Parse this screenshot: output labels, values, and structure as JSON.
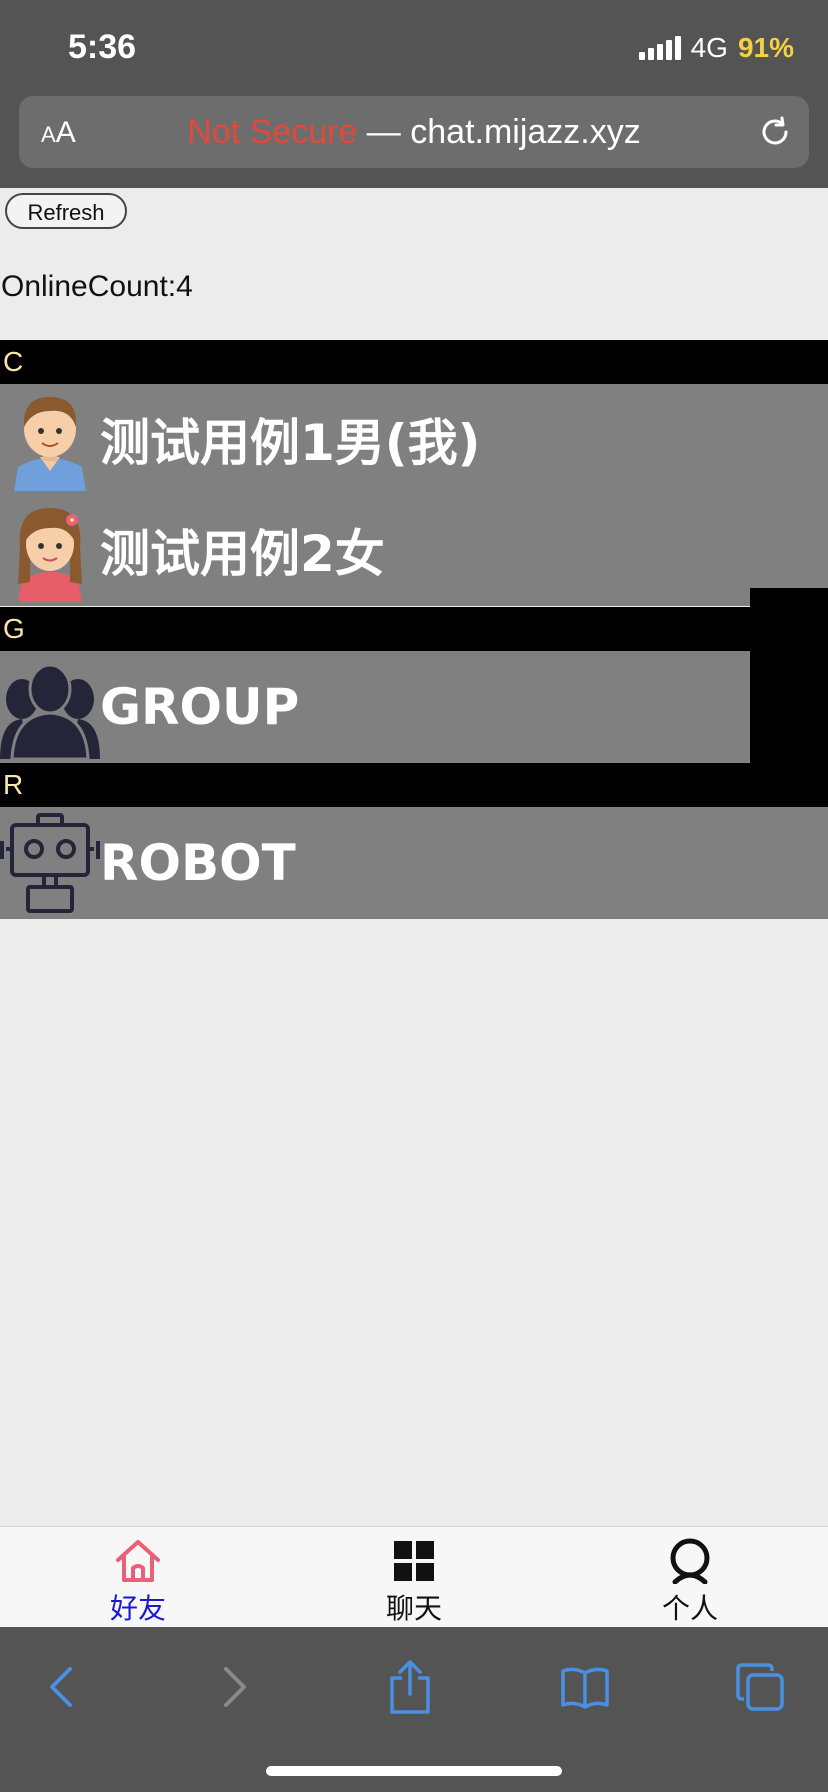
{
  "status": {
    "time": "5:36",
    "network": "4G",
    "battery": "91%"
  },
  "browser": {
    "aa_small": "A",
    "aa_large": "A",
    "not_secure": "Not Secure",
    "separator": " — ",
    "url": "chat.mijazz.xyz"
  },
  "page": {
    "refresh_label": "Refresh",
    "online_count": "OnlineCount:4",
    "sections": [
      {
        "letter": "C",
        "contacts": [
          {
            "name": "测试用例1男(我)",
            "avatar": "boy-avatar-icon"
          },
          {
            "name": "测试用例2女",
            "avatar": "girl-avatar-icon"
          }
        ]
      },
      {
        "letter": "G",
        "contacts": [
          {
            "name": "GROUP",
            "avatar": "group-icon"
          }
        ]
      },
      {
        "letter": "R",
        "contacts": [
          {
            "name": "ROBOT",
            "avatar": "robot-icon"
          }
        ]
      }
    ]
  },
  "tabbar": {
    "tabs": [
      {
        "label": "好友",
        "icon": "home-icon",
        "active": true
      },
      {
        "label": "聊天",
        "icon": "grid-icon",
        "active": false
      },
      {
        "label": "个人",
        "icon": "person-icon",
        "active": false
      }
    ]
  },
  "colors": {
    "chrome": "#545454",
    "section_bg": "#000000",
    "section_text": "#f7e6a8",
    "row_bg": "#808080",
    "active_tab_label": "#1a1ad6",
    "active_tab_icon": "#e8607a",
    "safari_blue": "#4a90e2",
    "not_secure": "#e5473b"
  }
}
